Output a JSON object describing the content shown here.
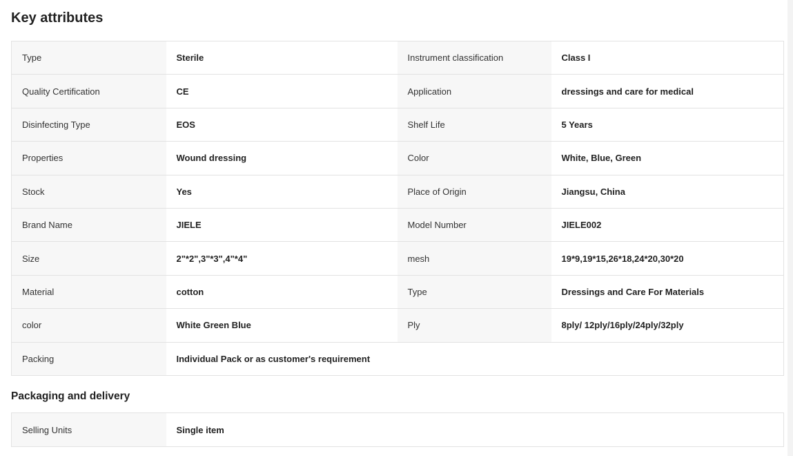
{
  "key_attributes": {
    "title": "Key attributes",
    "rows": [
      {
        "k1": "Type",
        "v1": "Sterile",
        "k2": "Instrument classification",
        "v2": "Class I"
      },
      {
        "k1": "Quality Certification",
        "v1": "CE",
        "k2": "Application",
        "v2": "dressings and care for medical"
      },
      {
        "k1": "Disinfecting Type",
        "v1": "EOS",
        "k2": "Shelf Life",
        "v2": "5 Years"
      },
      {
        "k1": "Properties",
        "v1": "Wound dressing",
        "k2": "Color",
        "v2": "White, Blue, Green"
      },
      {
        "k1": "Stock",
        "v1": "Yes",
        "k2": "Place of Origin",
        "v2": "Jiangsu, China"
      },
      {
        "k1": "Brand Name",
        "v1": "JIELE",
        "k2": "Model Number",
        "v2": "JIELE002"
      },
      {
        "k1": "Size",
        "v1": "2\"*2\",3\"*3\",4\"*4\"",
        "k2": "mesh",
        "v2": "19*9,19*15,26*18,24*20,30*20"
      },
      {
        "k1": "Material",
        "v1": "cotton",
        "k2": "Type",
        "v2": "Dressings and Care For Materials"
      },
      {
        "k1": "color",
        "v1": "White Green Blue",
        "k2": "Ply",
        "v2": "8ply/ 12ply/16ply/24ply/32ply"
      }
    ],
    "last_row": {
      "k1": "Packing",
      "v1": "Individual Pack or as customer's requirement"
    }
  },
  "packaging": {
    "title": "Packaging and delivery",
    "rows": [
      {
        "k1": "Selling Units",
        "v1": "Single item"
      }
    ]
  }
}
